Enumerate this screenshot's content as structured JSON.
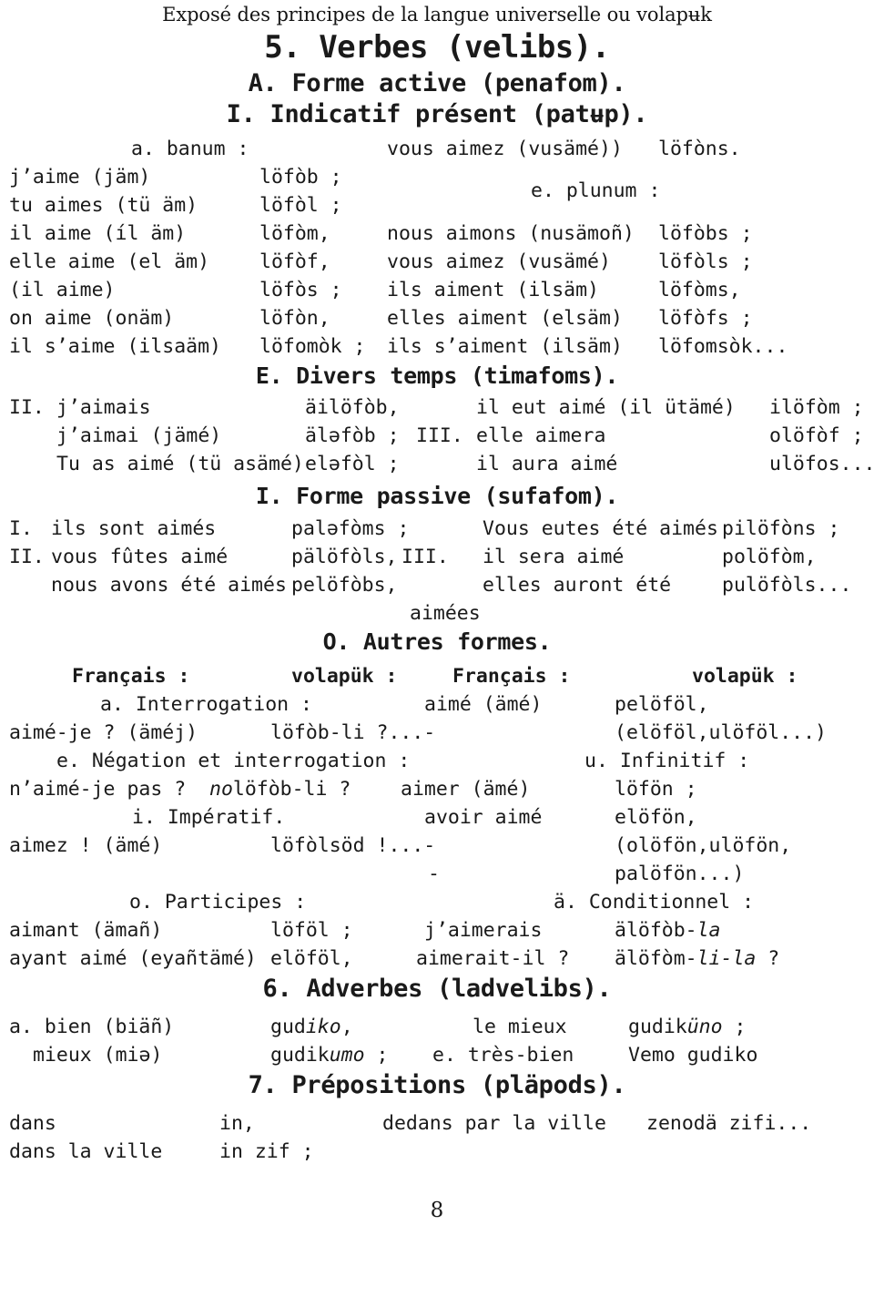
{
  "document": {
    "running_head": "Exposé des principes de la langue universelle ou volapʉk",
    "page_number": "8"
  },
  "headings": {
    "verbes": "5. Verbes (velibs).",
    "forme_active": "A. Forme active (penafom).",
    "indicatif_present": "I. Indicatif présent (patʉp).",
    "divers_temps": "E. Divers temps (timafoms).",
    "forme_passive": "I. Forme passive (sufafom).",
    "autres_formes": "O. Autres formes.",
    "adverbes": "6. Adverbes (ladvelibs).",
    "prepositions": "7. Prépositions (pläpods)."
  },
  "indicatif": {
    "label_banum": "a. banum :",
    "label_plunum": "e. plunum :",
    "top_right_french": "vous aimez (vusämé))",
    "top_right_volapuk": "löfòns.",
    "rows": [
      {
        "fr": "j’aime (jäm)",
        "vp": "löfòb ;",
        "fr2": "",
        "vp2": ""
      },
      {
        "fr": "tu aimes (tü äm)",
        "vp": "löfòl ;",
        "fr2": "",
        "vp2": ""
      },
      {
        "fr": "il aime (íl äm)",
        "vp": "löfòm,",
        "fr2": "nous aimons (nusämoñ)",
        "vp2": "löfòbs ;"
      },
      {
        "fr": "elle aime (el äm)",
        "vp": "löfòf,",
        "fr2": "vous aimez (vusämé)",
        "vp2": "löfòls ;"
      },
      {
        "fr": "(il aime)",
        "vp": "löfòs ;",
        "fr2": "ils aiment (ilsäm)",
        "vp2": "löfòms,"
      },
      {
        "fr": "on aime (onäm)",
        "vp": "löfòn,",
        "fr2": "elles aiment (elsäm)",
        "vp2": "löfòfs ;"
      },
      {
        "fr": "il s’aime (ilsaäm)",
        "vp": "löfomòk ;",
        "fr2": "ils s’aiment (ilsäm)",
        "vp2": "löfomsòk..."
      }
    ]
  },
  "divers_temps": {
    "rows": [
      {
        "num": "II.",
        "fr": "j’aimais",
        "vp": "äilöfòb,",
        "num2": "",
        "fr2": "il eut aimé (il ütämé)",
        "vp2": "ilöfòm ;"
      },
      {
        "num": "",
        "fr": "j’aimai (jämé)",
        "vp": "äləfòb ;",
        "num2": "III.",
        "fr2": "elle aimera",
        "vp2": "olöfòf ;"
      },
      {
        "num": "",
        "fr": "Tu as aimé (tü asämé)",
        "vp": "eləfòl ;",
        "num2": "",
        "fr2": "il aura aimé",
        "vp2": "ulöfos..."
      }
    ]
  },
  "forme_passive": {
    "rows": [
      {
        "num": "I.",
        "fr": "ils sont aimés",
        "vp": "paləfòms ;",
        "num2": "",
        "fr2": "Vous eutes été aimés",
        "vp2": "pilöfòns ;"
      },
      {
        "num": "II.",
        "fr": "vous fûtes aimé",
        "vp": "pälöfòls,",
        "num2": "III.",
        "fr2": "il sera aimé",
        "vp2": "polöfòm,"
      },
      {
        "num": "",
        "fr": "nous avons été aimés",
        "vp": "pelöfòbs,",
        "num2": "",
        "fr2": "elles auront été",
        "vp2": "pulöfòls..."
      }
    ],
    "trailing_center": "aimées"
  },
  "autres_formes": {
    "col_headers": {
      "french_left": "Français :",
      "volapuk_left": "volapük :",
      "french_right": "Français :",
      "volapuk_right": "volapük :"
    },
    "sub_interrogation": "a. Interrogation :",
    "sub_negation": "e. Négation et interrogation :",
    "sub_imperatif": "i. Impératif.",
    "sub_participes": "o. Participes :",
    "sub_infinitif": "u. Infinitif :",
    "sub_conditionnel": "ä. Conditionnel :",
    "rows": [
      {
        "fr": "aimé-je ? (äméj)",
        "vp": "löfòb-li ?...-",
        "fr2": "",
        "vp2": ""
      },
      {
        "fr": "n’aimé-je pas ?",
        "vp_italic": "no",
        "vp": "löfòb-li ?",
        "fr2": "",
        "vp2": ""
      },
      {
        "fr": "aimez ! (ämé)",
        "vp": "löfòlsöd !...-",
        "fr2": "",
        "vp2": ""
      },
      {
        "fr": "aimant (ämañ)",
        "vp": "löföl ;",
        "fr2": "",
        "vp2": ""
      },
      {
        "fr": "ayant aimé (eyañtämé)",
        "vp": "elöföl,",
        "fr2": "",
        "vp2": ""
      }
    ],
    "right_rows": [
      {
        "fr": "aimé (ämé)",
        "vp": "pelöföl,"
      },
      {
        "fr": "",
        "vp": "(elöföl,ulöföl...)"
      },
      {
        "fr": "aimer (ämé)",
        "vp": "löfön ;"
      },
      {
        "fr": "avoir aimé",
        "vp": "elöfön,"
      },
      {
        "fr": "",
        "vp": "(olöfön,ulöfön,"
      },
      {
        "fr": "",
        "vp": "palöfön...)"
      },
      {
        "fr": "j’aimerais",
        "vp": "älöfòb-",
        "vp_italic": "la"
      },
      {
        "fr": "aimerait-il ?",
        "vp": "älöfòm-",
        "vp_italic": "li-la",
        "vp_tail": " ?"
      }
    ],
    "dash_mark": "-"
  },
  "adverbes": {
    "rows": [
      {
        "fr": "a. bien (biäñ)",
        "vp_pre": "gud",
        "vp_it": "iko",
        "vp_post": ",",
        "fr2": "le mieux",
        "vp2_pre": "gudik",
        "vp2_it": "üno",
        "vp2_post": " ;"
      },
      {
        "fr": "mieux (miə)",
        "vp_pre": "gudik",
        "vp_it": "umo",
        "vp_post": " ;",
        "fr2": "e. très-bien",
        "vp2_pre": "Vemo gudiko",
        "vp2_it": "",
        "vp2_post": ""
      }
    ]
  },
  "prepositions": {
    "rows": [
      {
        "fr": "dans",
        "vp": "in,",
        "fr2": "dedans par la ville",
        "vp2": "zenodä zifi..."
      },
      {
        "fr": "dans la ville",
        "vp": "in zif ;",
        "fr2": "",
        "vp2": ""
      }
    ]
  }
}
